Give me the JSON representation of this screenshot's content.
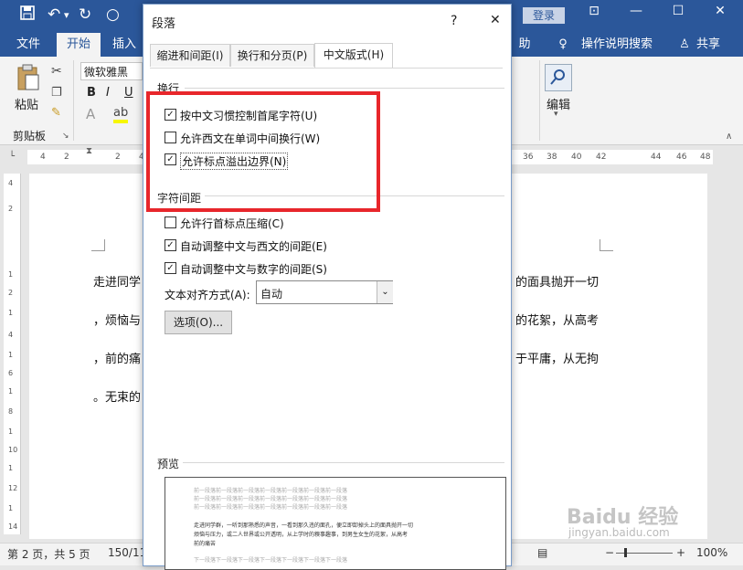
{
  "titlebar": {
    "login": "登录"
  },
  "ribbon_tabs": {
    "file": "文件",
    "home": "开始",
    "insert": "插入",
    "help": "助",
    "tell_me": "操作说明搜索",
    "share": "共享"
  },
  "ribbon": {
    "font_name": "微软雅黑",
    "paste": "粘贴",
    "clipboard_group": "剪贴板",
    "edit": "编辑",
    "bold": "B",
    "italic": "I",
    "underline": "U"
  },
  "ruler": {
    "ticks": [
      "4",
      "2",
      "2",
      "4",
      "36",
      "38",
      "40",
      "42",
      "44",
      "46",
      "48"
    ]
  },
  "vruler": {
    "ticks": [
      "4",
      "2",
      "1",
      "2",
      "1",
      "4",
      "1",
      "6",
      "1",
      "8",
      "1",
      "10",
      "1",
      "12",
      "1",
      "14"
    ]
  },
  "document": {
    "lines_left": [
      "走进同学",
      "，烦恼与",
      "，前的痛",
      "。无束的"
    ],
    "lines_right": [
      "的面具抛开一切",
      "的花絮，从高考",
      "于平庸，从无拘"
    ]
  },
  "dialog": {
    "title": "段落",
    "help": "?",
    "close": "✕",
    "tabs": [
      "缩进和间距(I)",
      "换行和分页(P)",
      "中文版式(H)"
    ],
    "section_wrap": "换行",
    "wrap_options": [
      {
        "label": "按中文习惯控制首尾字符(U)",
        "checked": true
      },
      {
        "label": "允许西文在单词中间换行(W)",
        "checked": false
      },
      {
        "label": "允许标点溢出边界(N)",
        "checked": true
      }
    ],
    "section_spacing": "字符间距",
    "spacing_options": [
      {
        "label": "允许行首标点压缩(C)",
        "checked": false
      },
      {
        "label": "自动调整中文与西文的间距(E)",
        "checked": true
      },
      {
        "label": "自动调整中文与数字的间距(S)",
        "checked": true
      }
    ],
    "align_label": "文本对齐方式(A):",
    "align_value": "自动",
    "options_button": "选项(O)...",
    "preview_label": "预览",
    "preview_prev": "前一段落前一段落前一段落前一段落前一段落前一段落前一段落",
    "preview_body1": "走进同学群，一听到那熟悉的声音，一看到那久违的面孔，便立即卸掉头上的面具抛开一切",
    "preview_body2": "烦恼与压力，或二人世界或公开透明，从上学时的糗事趣事，到男生女生的花絮，从高考",
    "preview_body3": "前的痛苦",
    "preview_next": "下一段落下一段落下一段落下一段落下一段落下一段落下一段落"
  },
  "status": {
    "page": "第 2 页，共 5 页",
    "words": "150/11",
    "zoom": "100%",
    "watermark": "Baidu 经验",
    "watermark_url": "jingyan.baidu.com"
  }
}
